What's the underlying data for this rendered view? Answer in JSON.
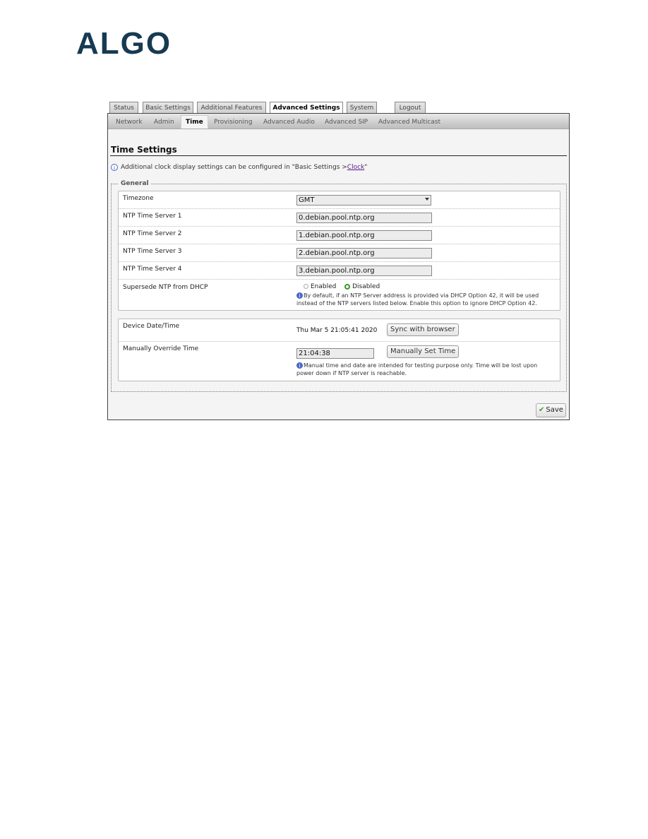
{
  "logo": {
    "text": "ALGO",
    "color": "#173a52"
  },
  "top_tabs": [
    {
      "label": "Status",
      "active": false
    },
    {
      "label": "Basic Settings",
      "active": false
    },
    {
      "label": "Additional Features",
      "active": false
    },
    {
      "label": "Advanced Settings",
      "active": true
    },
    {
      "label": "System",
      "active": false
    },
    {
      "label": "Logout",
      "active": false
    }
  ],
  "sub_tabs": [
    {
      "label": "Network",
      "active": false
    },
    {
      "label": "Admin",
      "active": false
    },
    {
      "label": "Time",
      "active": true
    },
    {
      "label": "Provisioning",
      "active": false
    },
    {
      "label": "Advanced Audio",
      "active": false
    },
    {
      "label": "Advanced SIP",
      "active": false
    },
    {
      "label": "Advanced Multicast",
      "active": false
    }
  ],
  "page": {
    "title": "Time Settings",
    "info_prefix": "Additional clock display settings can be configured in \"Basic Settings > ",
    "info_link": "Clock",
    "info_suffix": "\""
  },
  "general": {
    "legend": "General",
    "timezone": {
      "label": "Timezone",
      "value": "GMT"
    },
    "ntp_servers": [
      {
        "label": "NTP Time Server 1",
        "value": "0.debian.pool.ntp.org"
      },
      {
        "label": "NTP Time Server 2",
        "value": "1.debian.pool.ntp.org"
      },
      {
        "label": "NTP Time Server 3",
        "value": "2.debian.pool.ntp.org"
      },
      {
        "label": "NTP Time Server 4",
        "value": "3.debian.pool.ntp.org"
      }
    ],
    "supersede": {
      "label": "Supersede NTP from DHCP",
      "option_enabled": "Enabled",
      "option_disabled": "Disabled",
      "selected": "Disabled",
      "help_line1": "By default, if an NTP Server address is provided via DHCP Option 42, it will be used",
      "help_line2": "instead of the NTP servers listed below. Enable this option to ignore DHCP Option 42."
    },
    "device_time": {
      "label": "Device Date/Time",
      "value": "Thu Mar 5 21:05:41 2020",
      "button": "Sync with browser"
    },
    "override": {
      "label": "Manually Override Time",
      "value": "21:04:38",
      "button": "Manually Set Time",
      "help_line1": "Manual time and date are intended for testing purpose only. Time will be lost upon",
      "help_line2": "power down if NTP server is reachable."
    }
  },
  "save_label": "Save"
}
